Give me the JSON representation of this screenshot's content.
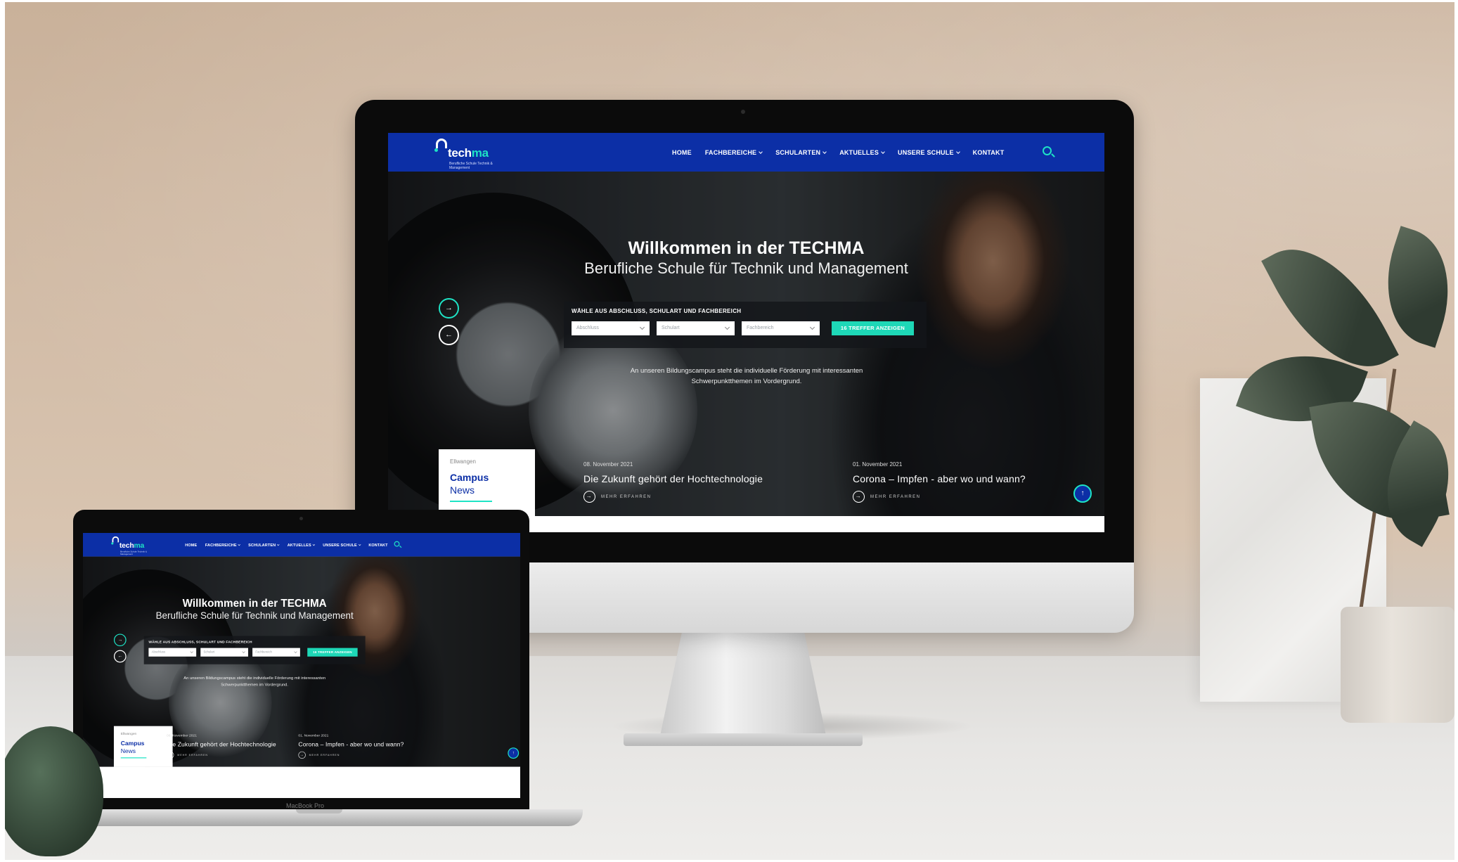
{
  "site": {
    "logo": {
      "text_a": "tech",
      "text_b": "ma",
      "subtitle": "Berufliche Schule Technik & Management"
    },
    "nav": {
      "items": [
        {
          "label": "HOME"
        },
        {
          "label": "FACHBEREICHE"
        },
        {
          "label": "SCHULARTEN"
        },
        {
          "label": "AKTUELLES"
        },
        {
          "label": "UNSERE SCHULE"
        },
        {
          "label": "KONTAKT"
        }
      ]
    },
    "hero": {
      "title": "Willkommen in der TECHMA",
      "subtitle": "Berufliche Schule für Technik und Management",
      "filter_label": "WÄHLE AUS ABSCHLUSS, SCHULART UND FACHBEREICH",
      "select_abschluss": "Abschluss",
      "select_schulart": "Schulart",
      "select_fachbereich": "Fachbereich",
      "cta": "16 TREFFER ANZEIGEN",
      "description": "An unseren Bildungscampus steht die individuelle Förderung mit interessanten Schwerpunktthemen im Vordergrund."
    },
    "campus": {
      "location": "Ellwangen",
      "title": "Campus",
      "subtitle": "News"
    },
    "news": [
      {
        "date": "08. November 2021",
        "title": "Die Zukunft gehört der Hochtechnologie",
        "more": "MEHR ERFAHREN"
      },
      {
        "date": "01. November 2021",
        "title": "Corona – Impfen - aber wo und wann?",
        "more": "MEHR ERFAHREN"
      }
    ],
    "colors": {
      "brand": "#0c2fa6",
      "accent": "#1ee3c5"
    }
  },
  "laptop": {
    "label": "MacBook Pro"
  }
}
